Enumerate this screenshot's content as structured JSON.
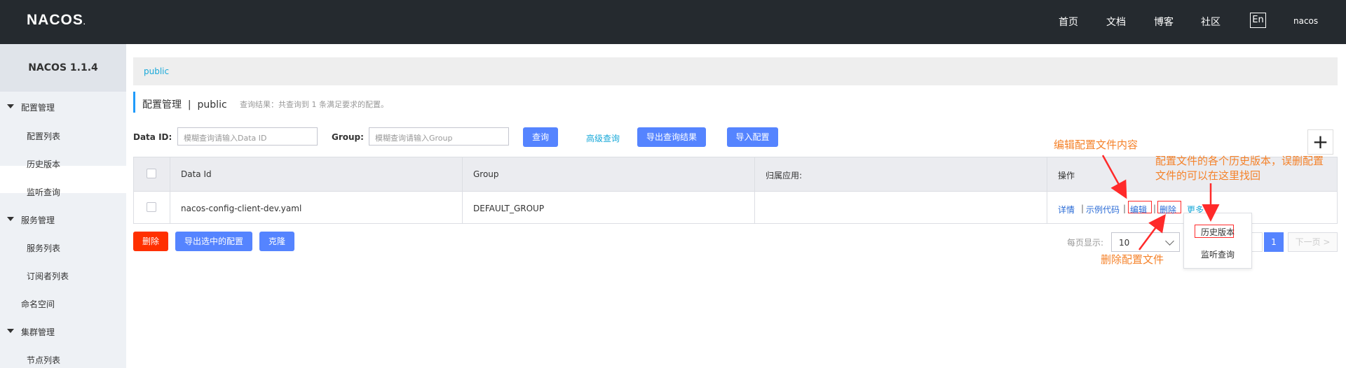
{
  "header": {
    "logo": "NACOS",
    "logo_dot": ".",
    "nav": [
      "首页",
      "文档",
      "博客",
      "社区"
    ],
    "lang": "En",
    "user": "nacos"
  },
  "sidebar": {
    "version": "NACOS 1.1.4",
    "groups": [
      {
        "label": "配置管理",
        "items": [
          "配置列表",
          "历史版本",
          "监听查询"
        ]
      },
      {
        "label": "服务管理",
        "items": [
          "服务列表",
          "订阅者列表"
        ]
      },
      {
        "label": "命名空间"
      },
      {
        "label": "集群管理",
        "items": [
          "节点列表"
        ]
      }
    ]
  },
  "breadcrumb": "public",
  "page": {
    "title": "配置管理",
    "separator": "|",
    "namespace": "public",
    "note": "查询结果：共查询到 1 条满足要求的配置。"
  },
  "search": {
    "dataid_label": "Data ID:",
    "dataid_placeholder": "模糊查询请输入Data ID",
    "group_label": "Group:",
    "group_placeholder": "模糊查询请输入Group",
    "query_btn": "查询",
    "advanced": "高级查询",
    "export_btn": "导出查询结果",
    "import_btn": "导入配置",
    "add_icon": "+"
  },
  "table": {
    "headers": [
      "Data Id",
      "Group",
      "归属应用:",
      "操作"
    ],
    "rows": [
      {
        "data_id": "nacos-config-client-dev.yaml",
        "group": "DEFAULT_GROUP",
        "app": "",
        "ops": [
          "详情",
          "示例代码",
          "编辑",
          "删除",
          "更多"
        ],
        "sep": "|"
      }
    ]
  },
  "bottom": {
    "delete_btn": "删除",
    "export_sel_btn": "导出选中的配置",
    "clone_btn": "克隆"
  },
  "pager": {
    "page_size_label": "每页显示:",
    "page_size": "10",
    "current_page": "1",
    "next": "下一页 >"
  },
  "more_menu": [
    "历史版本",
    "监听查询"
  ],
  "annotations": {
    "edit": "编辑配置文件内容",
    "history_line1": "配置文件的各个历史版本，误删配置",
    "history_line2": "文件的可以在这里找回",
    "delete": "删除配置文件"
  },
  "colors": {
    "topbar": "#252a2f",
    "primary": "#5584ff",
    "danger": "#ff3000",
    "link": "#19a9d9",
    "annotation": "#f5822a"
  }
}
